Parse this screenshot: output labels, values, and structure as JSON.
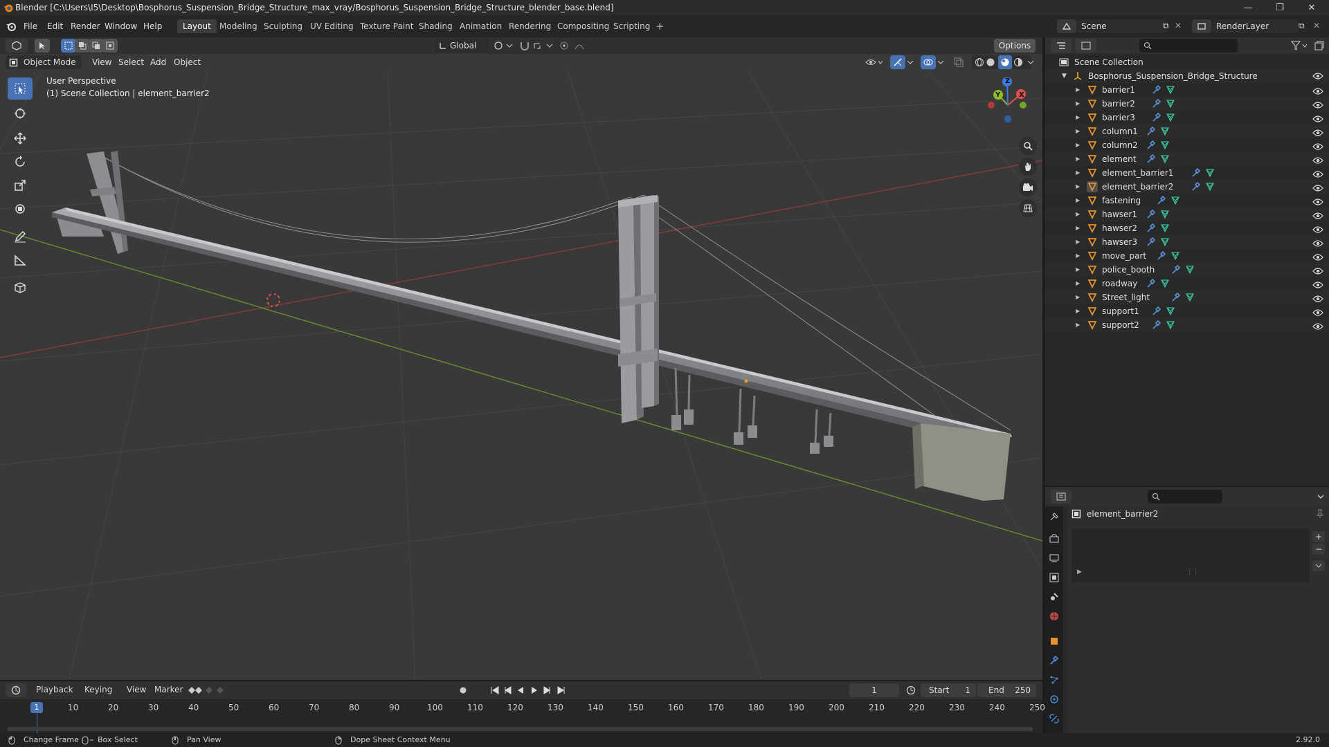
{
  "window": {
    "title": "Blender [C:\\Users\\I5\\Desktop\\Bosphorus_Suspension_Bridge_Structure_max_vray/Bosphorus_Suspension_Bridge_Structure_blender_base.blend]"
  },
  "menus": [
    "File",
    "Edit",
    "Render",
    "Window",
    "Help"
  ],
  "workspaces": [
    "Layout",
    "Modeling",
    "Sculpting",
    "UV Editing",
    "Texture Paint",
    "Shading",
    "Animation",
    "Rendering",
    "Compositing",
    "Scripting"
  ],
  "active_workspace": "Layout",
  "scene": {
    "name": "Scene",
    "view_layer": "RenderLayer"
  },
  "header": {
    "transform_orientation": "Global",
    "options_label": "Options"
  },
  "viewport_header": {
    "mode": "Object Mode",
    "menus": [
      "View",
      "Select",
      "Add",
      "Object"
    ]
  },
  "viewport": {
    "perspective": "User Perspective",
    "context": "(1) Scene Collection | element_barrier2",
    "gizmo_axes": [
      "X",
      "Y",
      "Z"
    ]
  },
  "outliner": {
    "root": "Scene Collection",
    "collection": "Bosphorus_Suspension_Bridge_Structure",
    "items": [
      "barrier1",
      "barrier2",
      "barrier3",
      "column1",
      "column2",
      "element",
      "element_barrier1",
      "element_barrier2",
      "fastening",
      "hawser1",
      "hawser2",
      "hawser3",
      "move_part",
      "police_booth",
      "roadway",
      "Street_light",
      "support1",
      "support2"
    ],
    "selected": "element_barrier2"
  },
  "properties": {
    "object_name": "element_barrier2"
  },
  "timeline": {
    "menus": [
      "Playback",
      "Keying",
      "View",
      "Marker"
    ],
    "current_frame": "1",
    "start_label": "Start",
    "start": "1",
    "end_label": "End",
    "end": "250",
    "ruler": [
      "1",
      "10",
      "20",
      "30",
      "40",
      "50",
      "60",
      "70",
      "80",
      "90",
      "100",
      "110",
      "120",
      "130",
      "140",
      "150",
      "160",
      "170",
      "180",
      "190",
      "200",
      "210",
      "220",
      "230",
      "240",
      "250"
    ]
  },
  "statusbar": {
    "items": [
      "Change Frame",
      "Box Select",
      "Pan View",
      "Dope Sheet Context Menu"
    ],
    "version": "2.92.0"
  }
}
